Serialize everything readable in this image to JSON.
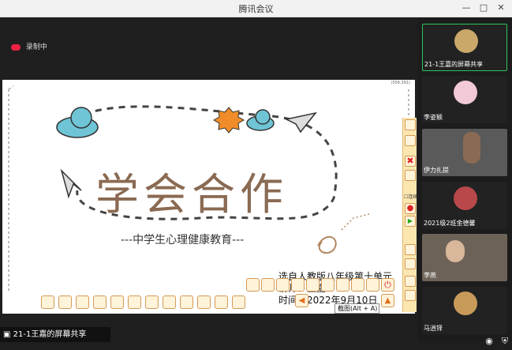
{
  "window": {
    "title": "腾讯会议"
  },
  "recording": {
    "label": "录制中"
  },
  "slide": {
    "coord": "(556,391)",
    "title": "学会合作",
    "subtitle": "---中学生心理健康教育---",
    "source_line": "选自人教版八年级第十单元",
    "presenter_line": "讲师：王嘉",
    "time_line": "时间：2022年9月10日"
  },
  "tooltip": {
    "text": "截图(Alt + A)"
  },
  "side_toolbar": {
    "checkbox_label": "连续"
  },
  "share_status": {
    "text": "21-1王嘉的屏幕共享"
  },
  "participants": [
    {
      "name": "21-1王嘉的屏幕共享",
      "active": true
    },
    {
      "name": "李姿颖",
      "active": false
    },
    {
      "name": "伊力扎提",
      "active": false
    },
    {
      "name": "2021级2班金德馨",
      "active": false
    },
    {
      "name": "李燕",
      "active": false
    },
    {
      "name": "马逍铎",
      "active": false
    }
  ],
  "colors": {
    "accent": "#2fc45b",
    "title_brown": "#8a6a52",
    "sticker_orange": "#f08c2a",
    "cloud_blue": "#6fc4d6"
  }
}
